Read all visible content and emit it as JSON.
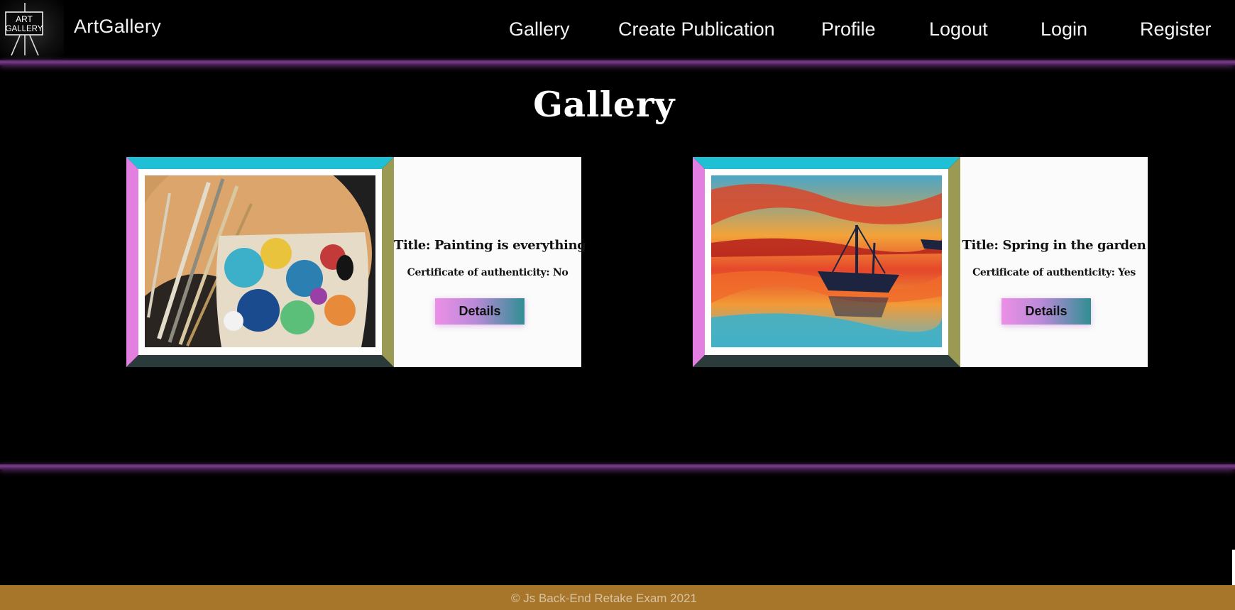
{
  "header": {
    "logo": {
      "line1": "ART",
      "line2": "GALLERY",
      "icon": "easel-icon"
    },
    "brand": "ArtGallery",
    "nav": [
      {
        "label": "Gallery"
      },
      {
        "label": "Create Publication"
      },
      {
        "label": "Profile"
      },
      {
        "label": "Logout"
      },
      {
        "label": "Login"
      },
      {
        "label": "Register"
      }
    ]
  },
  "main": {
    "title": "Gallery",
    "cards": [
      {
        "title": "Title: Painting is everything",
        "certificate": "Certificate of authenticity: No",
        "button": "Details",
        "image": "palette-and-brushes-painting"
      },
      {
        "title": "Title: Spring in the garden",
        "certificate": "Certificate of authenticity: Yes",
        "button": "Details",
        "image": "boat-at-sunset-painting"
      }
    ]
  },
  "footer": {
    "text": "© Js Back-End Retake Exam 2021"
  },
  "colors": {
    "background": "#000000",
    "accent_line": "#7a3d8c",
    "footer_bg": "#a8762b",
    "frame_top": "#1fc0d6",
    "frame_left": "#e37fe0",
    "frame_right": "#9b9a55",
    "frame_bottom": "#2b3a3a",
    "button_gradient_start": "#ec8fe6",
    "button_gradient_end": "#2f8f92"
  }
}
